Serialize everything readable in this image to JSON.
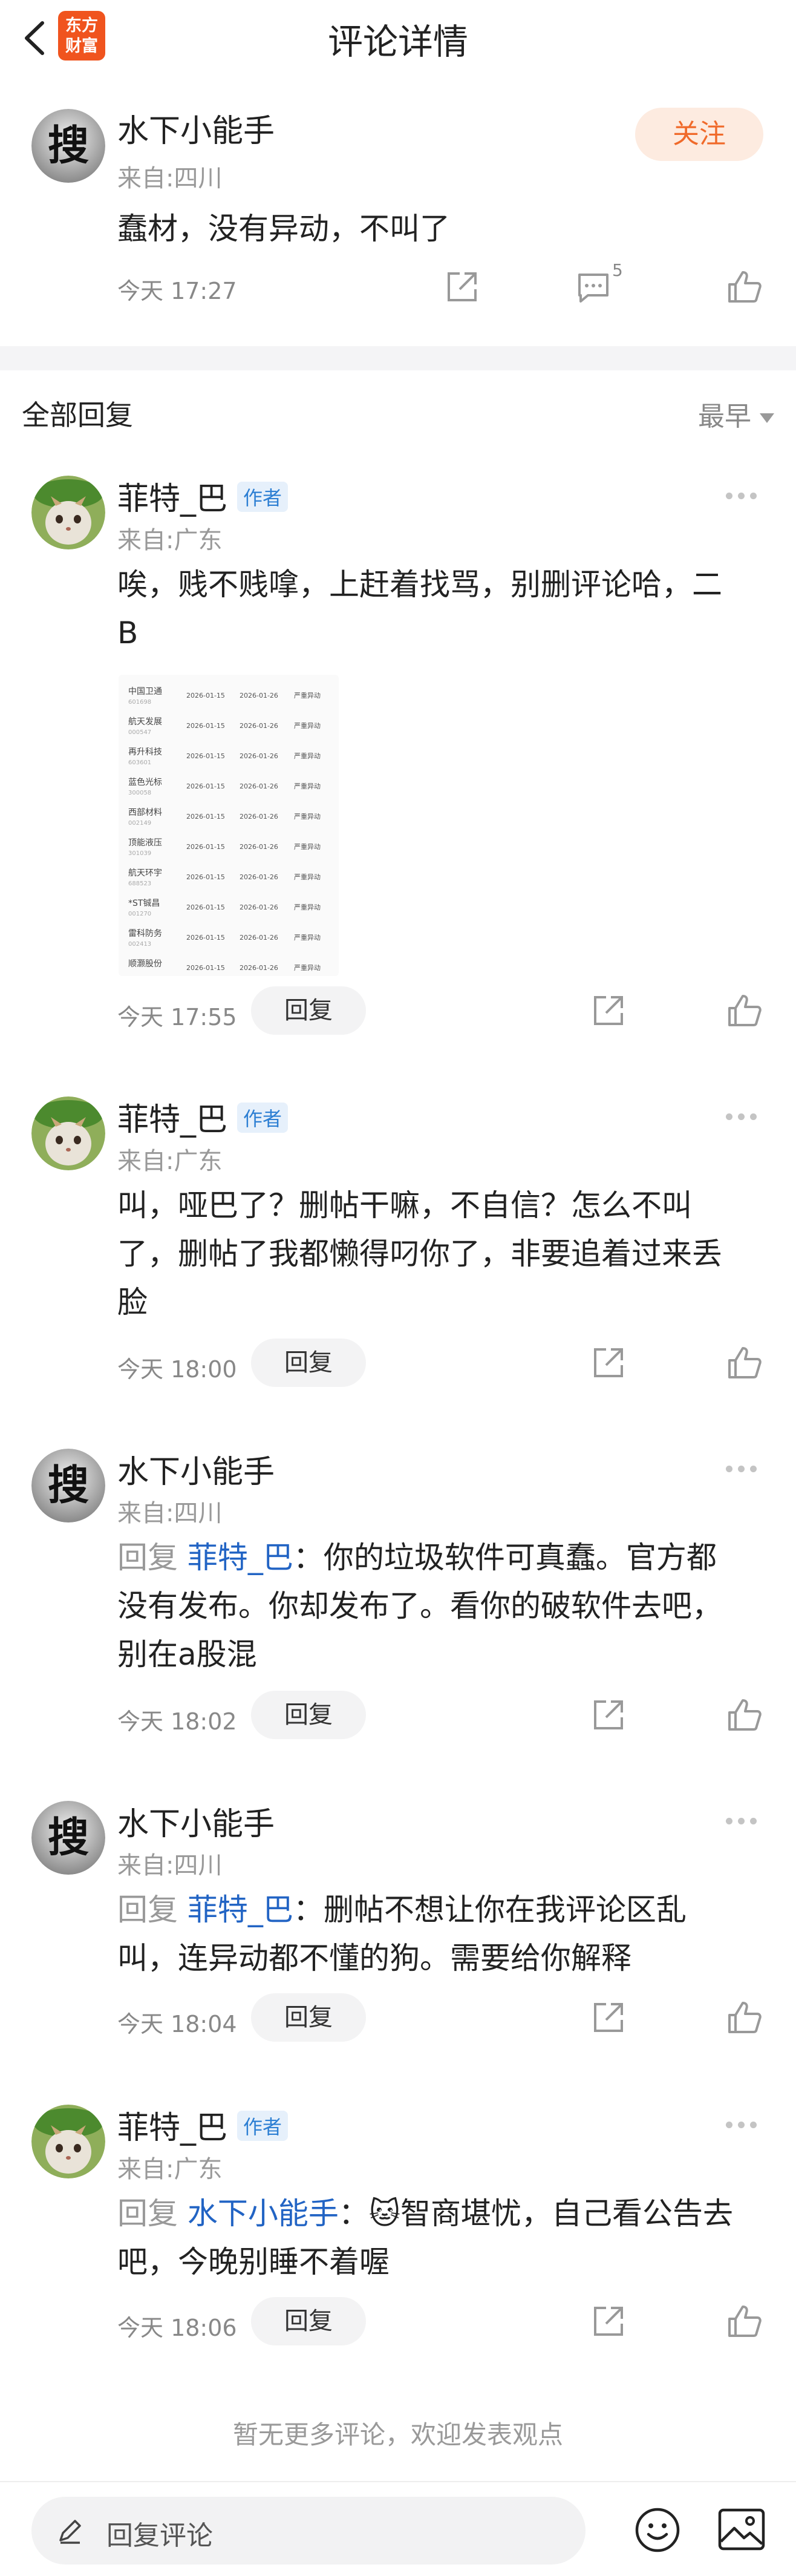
{
  "header": {
    "title": "评论详情",
    "logo_line1": "东方",
    "logo_line2": "财富"
  },
  "main_comment": {
    "username": "水下小能手",
    "location": "来自:四川",
    "text": "蠢材，没有异动，不叫了",
    "time": "今天 17:27",
    "follow_label": "关注",
    "comment_count": "5",
    "avatar_char": "搜"
  },
  "section": {
    "title": "全部回复",
    "sort_label": "最早"
  },
  "replies": [
    {
      "username": "菲特_巴",
      "author_tag": "作者",
      "location": "来自:广东",
      "text_line1": "唉，贱不贱嗱，上赶着找骂，别删评论哈，二",
      "text_line2": "B",
      "time": "今天 17:55",
      "reply_label": "回复"
    },
    {
      "username": "菲特_巴",
      "author_tag": "作者",
      "location": "来自:广东",
      "text_line1": "叫，哑巴了？删帖干嘛，不自信？怎么不叫",
      "text_line2": "了，删帖了我都懒得叼你了，非要追着过来丢",
      "text_line3": "脸",
      "time": "今天 18:00",
      "reply_label": "回复"
    },
    {
      "username": "水下小能手",
      "location": "来自:四川",
      "avatar_char": "搜",
      "reply_prefix": "回复 ",
      "reply_target": "菲特_巴",
      "text_line1": "：你的垃圾软件可真蠢。官方都",
      "text_line2": "没有发布。你却发布了。看你的破软件去吧，",
      "text_line3": "别在a股混",
      "time": "今天 18:02",
      "reply_label": "回复"
    },
    {
      "username": "水下小能手",
      "location": "来自:四川",
      "avatar_char": "搜",
      "reply_prefix": "回复 ",
      "reply_target": "菲特_巴",
      "text_line1": "：删帖不想让你在我评论区乱",
      "text_line2": "叫，连异动都不懂的狗。需要给你解释",
      "time": "今天 18:04",
      "reply_label": "回复"
    },
    {
      "username": "菲特_巴",
      "author_tag": "作者",
      "location": "来自:广东",
      "reply_prefix": "回复 ",
      "reply_target": "水下小能手",
      "text_line1": "：🐱智商堪忧，自己看公告去",
      "text_line2": "吧，今晚别睡不着喔",
      "time": "今天 18:06",
      "reply_label": "回复"
    }
  ],
  "table_image": {
    "rows": [
      {
        "name": "中国卫通",
        "code": "601698",
        "d1": "2026-01-15",
        "d2": "2026-01-26",
        "status": "严重异动"
      },
      {
        "name": "航天发展",
        "code": "000547",
        "d1": "2026-01-15",
        "d2": "2026-01-26",
        "status": "严重异动"
      },
      {
        "name": "再升科技",
        "code": "603601",
        "d1": "2026-01-15",
        "d2": "2026-01-26",
        "status": "严重异动"
      },
      {
        "name": "蓝色光标",
        "code": "300058",
        "d1": "2026-01-15",
        "d2": "2026-01-26",
        "status": "严重异动"
      },
      {
        "name": "西部材料",
        "code": "002149",
        "d1": "2026-01-15",
        "d2": "2026-01-26",
        "status": "严重异动"
      },
      {
        "name": "顶能液压",
        "code": "301039",
        "d1": "2026-01-15",
        "d2": "2026-01-26",
        "status": "严重异动"
      },
      {
        "name": "航天环宇",
        "code": "688523",
        "d1": "2026-01-15",
        "d2": "2026-01-26",
        "status": "严重异动"
      },
      {
        "name": "*ST铖昌",
        "code": "001270",
        "d1": "2026-01-15",
        "d2": "2026-01-26",
        "status": "严重异动"
      },
      {
        "name": "雷科防务",
        "code": "002413",
        "d1": "2026-01-15",
        "d2": "2026-01-26",
        "status": "严重异动"
      },
      {
        "name": "顺灏股份",
        "code": "",
        "d1": "2026-01-15",
        "d2": "2026-01-26",
        "status": "严重异动"
      }
    ]
  },
  "footer": {
    "no_more": "暂无更多评论，欢迎发表观点",
    "input_placeholder": "回复评论"
  },
  "icons": {
    "back": "chevron-left-icon",
    "share": "share-icon",
    "comment": "comment-icon",
    "like": "thumbs-up-icon",
    "more": "more-dots-icon",
    "pen": "pen-icon",
    "emoji": "emoji-icon",
    "image": "image-icon"
  },
  "colors": {
    "accent": "#f06a2a",
    "link": "#2264c4",
    "author_tag_bg": "#e6f0fb"
  }
}
